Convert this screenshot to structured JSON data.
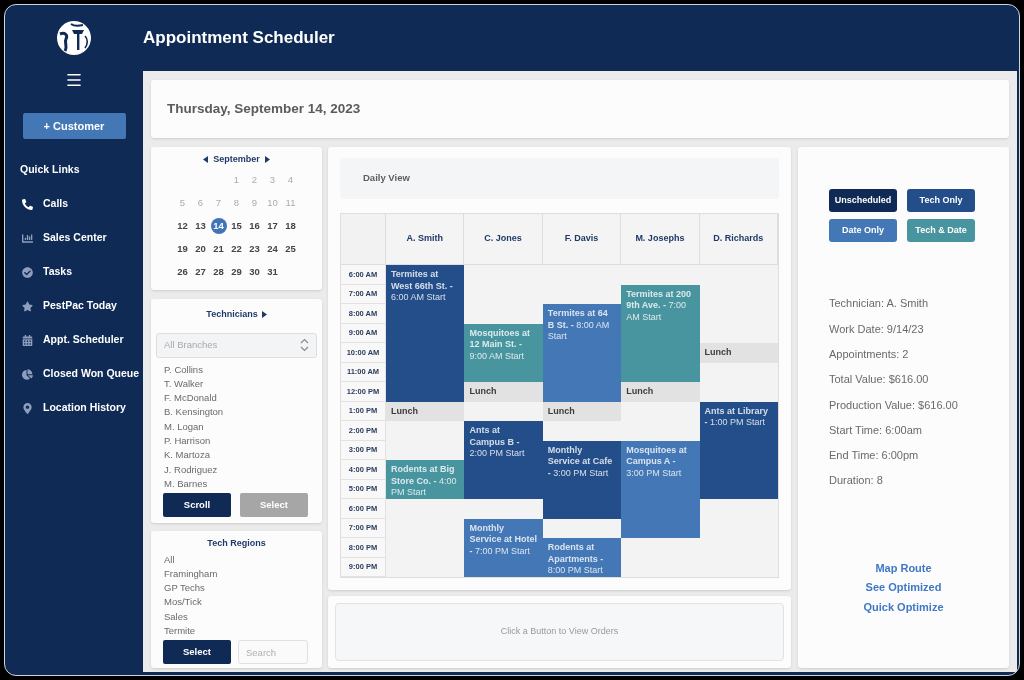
{
  "window": {
    "title": "Appointment Scheduler"
  },
  "sidebar": {
    "add_button": "+ Customer",
    "quick_links_title": "Quick Links",
    "items": [
      {
        "label": "Calls"
      },
      {
        "label": "Sales Center"
      },
      {
        "label": "Tasks"
      },
      {
        "label": "PestPac Today"
      },
      {
        "label": "Appt. Scheduler"
      },
      {
        "label": "Closed Won Queue"
      },
      {
        "label": "Location History"
      }
    ]
  },
  "date_header": "Thursday, September 14, 2023",
  "calendar": {
    "month": "September",
    "weeks": [
      [
        {
          "label": "1",
          "muted": true,
          "selected": false
        },
        {
          "label": "2",
          "muted": true,
          "selected": false
        },
        {
          "label": "3",
          "muted": true,
          "selected": false
        },
        {
          "label": "4",
          "muted": true,
          "selected": false
        }
      ],
      [
        {
          "label": "5",
          "muted": true,
          "selected": false
        },
        {
          "label": "6",
          "muted": true,
          "selected": false
        },
        {
          "label": "7",
          "muted": true,
          "selected": false
        },
        {
          "label": "8",
          "muted": true,
          "selected": false
        },
        {
          "label": "9",
          "muted": true,
          "selected": false
        },
        {
          "label": "10",
          "muted": true,
          "selected": false
        },
        {
          "label": "11",
          "muted": true,
          "selected": false
        }
      ],
      [
        {
          "label": "12",
          "muted": false,
          "selected": false
        },
        {
          "label": "13",
          "muted": false,
          "selected": false
        },
        {
          "label": "14",
          "muted": false,
          "selected": true
        },
        {
          "label": "15",
          "muted": false,
          "selected": false
        },
        {
          "label": "16",
          "muted": false,
          "selected": false
        },
        {
          "label": "17",
          "muted": false,
          "selected": false
        },
        {
          "label": "18",
          "muted": false,
          "selected": false
        }
      ],
      [
        {
          "label": "19",
          "muted": false,
          "selected": false
        },
        {
          "label": "20",
          "muted": false,
          "selected": false
        },
        {
          "label": "21",
          "muted": false,
          "selected": false
        },
        {
          "label": "22",
          "muted": false,
          "selected": false
        },
        {
          "label": "23",
          "muted": false,
          "selected": false
        },
        {
          "label": "24",
          "muted": false,
          "selected": false
        },
        {
          "label": "25",
          "muted": false,
          "selected": false
        }
      ],
      [
        {
          "label": "26",
          "muted": false,
          "selected": false
        },
        {
          "label": "27",
          "muted": false,
          "selected": false
        },
        {
          "label": "28",
          "muted": false,
          "selected": false
        },
        {
          "label": "29",
          "muted": false,
          "selected": false
        },
        {
          "label": "30",
          "muted": false,
          "selected": false
        },
        {
          "label": "31",
          "muted": false,
          "selected": false
        }
      ]
    ]
  },
  "technicians": {
    "title": "Technicians",
    "branch_select": {
      "placeholder": "All Branches"
    },
    "names": [
      "P. Collins",
      "T. Walker",
      "F. McDonald",
      "B. Kensington",
      "M. Logan",
      "P. Harrison",
      "K. Martoza",
      "J. Rodriguez",
      "M. Barnes"
    ],
    "buttons": [
      {
        "label": "Scroll",
        "disabled": false
      },
      {
        "label": "Select",
        "disabled": true
      }
    ]
  },
  "tech_regions": {
    "title": "Tech Regions",
    "items": [
      "All",
      "Framingham",
      "GP Techs",
      "Mos/Tick",
      "Sales",
      "Termite"
    ],
    "select_button": {
      "label": "Select"
    },
    "search": {
      "placeholder": "Search"
    }
  },
  "schedule": {
    "title": "Daily View",
    "times": [
      "6:00 AM",
      "7:00 AM",
      "8:00 AM",
      "9:00 AM",
      "10:00 AM",
      "11:00 AM",
      "12:00 PM",
      "1:00 PM",
      "2:00 PM",
      "3:00 PM",
      "4:00 PM",
      "5:00 PM",
      "6:00 PM",
      "7:00 PM",
      "8:00 PM",
      "9:00 PM"
    ],
    "technicians": [
      {
        "name": "A. Smith",
        "slots": [
          {
            "kind": "appointment",
            "text": "**Termites at West 66th St. -** 6:00 AM Start",
            "color": "#234e8a"
          },
          {
            "kind": "continued"
          },
          {
            "kind": "continued"
          },
          {
            "kind": "continued"
          },
          {
            "kind": "continued"
          },
          {
            "kind": "continued"
          },
          {
            "kind": "continued"
          },
          {
            "kind": "lunch",
            "text": "Lunch"
          },
          {
            "kind": "free"
          },
          {
            "kind": "free"
          },
          {
            "kind": "appointment",
            "text": "**Rodents at Big Store Co. -** 4:00 PM Start",
            "color": "#4895a0"
          },
          {
            "kind": "continued"
          },
          {
            "kind": "free"
          },
          {
            "kind": "free"
          },
          {
            "kind": "free"
          },
          {
            "kind": "free"
          }
        ]
      },
      {
        "name": "C. Jones",
        "slots": [
          {
            "kind": "free"
          },
          {
            "kind": "free"
          },
          {
            "kind": "free"
          },
          {
            "kind": "appointment",
            "text": "**Mosquitoes at 12 Main St. -** 9:00 AM Start",
            "color": "#4895a0"
          },
          {
            "kind": "continued"
          },
          {
            "kind": "continued"
          },
          {
            "kind": "lunch",
            "text": "Lunch"
          },
          {
            "kind": "free"
          },
          {
            "kind": "appointment",
            "text": "**Ants at Campus B -** 2:00 PM Start",
            "color": "#234e8a"
          },
          {
            "kind": "continued"
          },
          {
            "kind": "continued"
          },
          {
            "kind": "continued"
          },
          {
            "kind": "free"
          },
          {
            "kind": "appointment",
            "text": "**Monthly Service at Hotel -** 7:00 PM Start",
            "color": "#4377b5"
          },
          {
            "kind": "continued"
          },
          {
            "kind": "continued"
          }
        ]
      },
      {
        "name": "F. Davis",
        "slots": [
          {
            "kind": "free"
          },
          {
            "kind": "free"
          },
          {
            "kind": "appointment",
            "text": "**Termites at 64 B St. -** 8:00 AM Start",
            "color": "#4377b5"
          },
          {
            "kind": "continued"
          },
          {
            "kind": "continued"
          },
          {
            "kind": "continued"
          },
          {
            "kind": "continued"
          },
          {
            "kind": "lunch",
            "text": "Lunch"
          },
          {
            "kind": "free"
          },
          {
            "kind": "appointment",
            "text": "**Monthly Service at Cafe -** 3:00 PM Start",
            "color": "#234e8a"
          },
          {
            "kind": "continued"
          },
          {
            "kind": "continued"
          },
          {
            "kind": "continued"
          },
          {
            "kind": "free"
          },
          {
            "kind": "appointment",
            "text": "**Rodents at Apartments -** 8:00 PM Start",
            "color": "#4377b5"
          },
          {
            "kind": "continued"
          }
        ]
      },
      {
        "name": "M. Josephs",
        "slots": [
          {
            "kind": "free"
          },
          {
            "kind": "appointment",
            "text": "**Termites at 200 9th Ave. -** 7:00 AM Start",
            "color": "#4895a0"
          },
          {
            "kind": "continued"
          },
          {
            "kind": "continued"
          },
          {
            "kind": "continued"
          },
          {
            "kind": "continued"
          },
          {
            "kind": "lunch",
            "text": "Lunch"
          },
          {
            "kind": "free"
          },
          {
            "kind": "free"
          },
          {
            "kind": "appointment",
            "text": "**Mosquitoes at Campus A -** 3:00 PM Start",
            "color": "#4377b5"
          },
          {
            "kind": "continued"
          },
          {
            "kind": "continued"
          },
          {
            "kind": "continued"
          },
          {
            "kind": "continued"
          },
          {
            "kind": "free"
          },
          {
            "kind": "free"
          }
        ]
      },
      {
        "name": "D. Richards",
        "slots": [
          {
            "kind": "free"
          },
          {
            "kind": "free"
          },
          {
            "kind": "free"
          },
          {
            "kind": "free"
          },
          {
            "kind": "lunch",
            "text": "Lunch"
          },
          {
            "kind": "free"
          },
          {
            "kind": "free"
          },
          {
            "kind": "appointment",
            "text": "**Ants at Library -** 1:00 PM Start",
            "color": "#234e8a"
          },
          {
            "kind": "continued"
          },
          {
            "kind": "continued"
          },
          {
            "kind": "continued"
          },
          {
            "kind": "continued"
          },
          {
            "kind": "free"
          },
          {
            "kind": "free"
          },
          {
            "kind": "free"
          },
          {
            "kind": "free"
          }
        ]
      }
    ]
  },
  "orders": {
    "message": "Click a Button to View Orders"
  },
  "filters": [
    {
      "label": "Unscheduled",
      "color": "#0f2a55"
    },
    {
      "label": "Tech Only",
      "color": "#234e8a"
    },
    {
      "label": "Date Only",
      "color": "#4377b5"
    },
    {
      "label": "Tech & Date",
      "color": "#4895a0"
    }
  ],
  "summary": [
    "Technician: A. Smith",
    "Work Date: 9/14/23",
    "Appointments: 2",
    "Total Value: $616.00",
    "Production Value: $616.00",
    "Start Time: 6:00am",
    "End Time: 6:00pm",
    "Duration: 8"
  ],
  "links": [
    "Map Route",
    "See Optimized",
    "Quick Optimize"
  ]
}
